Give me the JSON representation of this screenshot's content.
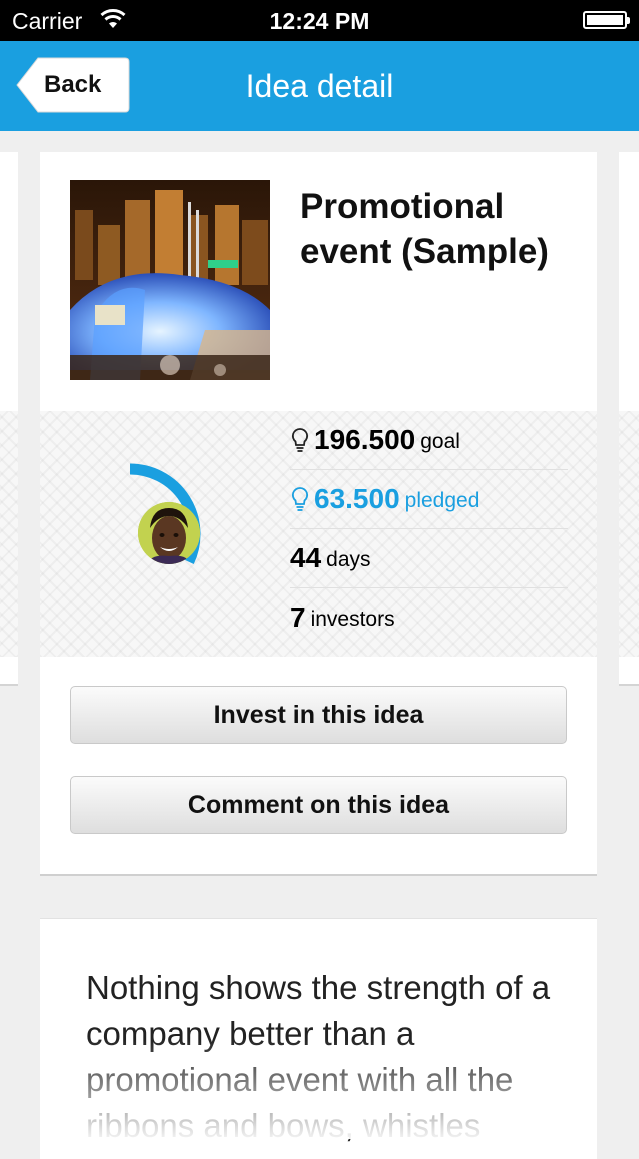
{
  "status_bar": {
    "carrier": "Carrier",
    "time": "12:24 PM"
  },
  "nav": {
    "back_label": "Back",
    "title": "Idea detail"
  },
  "idea": {
    "title": "Promotional event (Sample)",
    "image_icon": "event-photo",
    "stats": {
      "goal_value": "196.500",
      "goal_label": "goal",
      "pledged_value": "63.500",
      "pledged_label": "pledged",
      "days_value": "44",
      "days_label": "days",
      "investors_value": "7",
      "investors_label": "investors"
    },
    "progress_fraction": 0.32,
    "actions": {
      "invest_label": "Invest in this idea",
      "comment_label": "Comment on this idea"
    },
    "description": "Nothing shows the strength of a company better than a promotional event with all the ribbons and bows, whistles"
  },
  "colors": {
    "accent": "#1a9fe0",
    "nav_bar": "#1a9fe0",
    "background": "#efefef"
  }
}
